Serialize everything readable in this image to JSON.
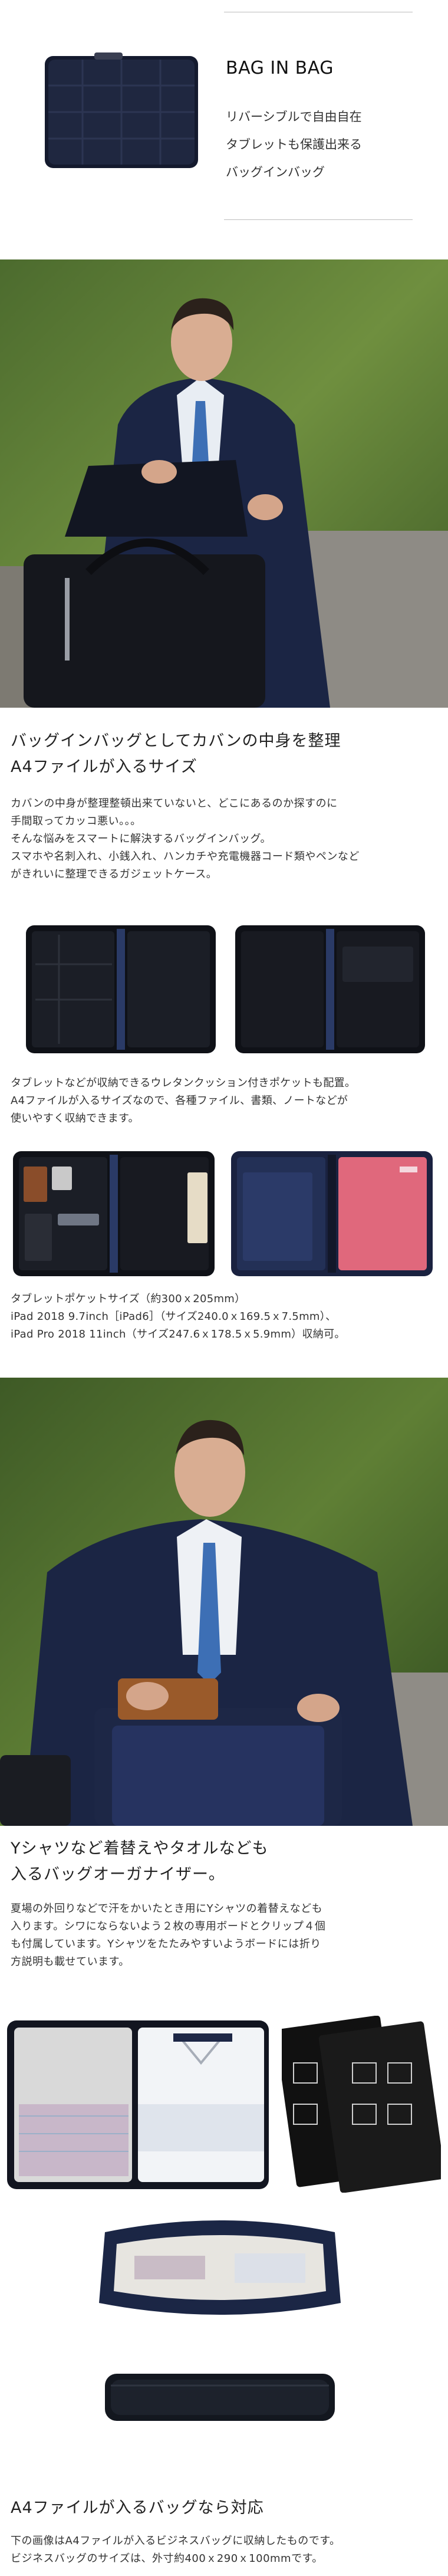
{
  "header": {
    "title": "BAG IN BAG",
    "tagline": [
      "リバーシブルで自由自在",
      "タブレットも保護出来る",
      "バッグインバッグ"
    ]
  },
  "section1": {
    "heading": [
      "バッグインバッグとしてカバンの中身を整理",
      "A4ファイルが入るサイズ"
    ],
    "body": [
      "カバンの中身が整理整頓出来ていないと、どこにあるのか探すのに",
      "手間取ってカッコ悪い。。。",
      "そんな悩みをスマートに解決するバッグインバッグ。",
      "スマホや名刺入れ、小銭入れ、ハンカチや充電機器コード類やペンなど",
      "がきれいに整理できるガジェットケース。"
    ],
    "caption1": [
      "タブレットなどが収納できるウレタンクッション付きポケットも配置。",
      "A4ファイルが入るサイズなので、各種ファイル、書類、ノートなどが",
      "使いやすく収納できます。"
    ],
    "caption2": [
      "タブレットポケットサイズ（約300ｘ205mm）",
      "iPad 2018 9.7inch［iPad6］（サイズ240.0ｘ169.5ｘ7.5mm）、",
      "iPad Pro 2018 11inch（サイズ247.6ｘ178.5ｘ5.9mm）収納可。"
    ]
  },
  "section2": {
    "heading": [
      "Yシャツなど着替えやタオルなども",
      "入るバッグオーガナイザー。"
    ],
    "body": [
      "夏場の外回りなどで汗をかいたとき用にYシャツの着替えなども",
      "入ります。シワにならないよう２枚の専用ボードとクリップ４個",
      "も付属しています。Yシャツをたたみやすいようボードには折り",
      "方説明も載せています。"
    ]
  },
  "section3": {
    "heading": "A4ファイルが入るバッグなら対応",
    "body": [
      "下の画像はA4ファイルが入るビジネスバッグに収納したものです。",
      "ビジネスバッグのサイズは、外寸約400ｘ290ｘ100mmです。"
    ]
  },
  "colors": {
    "navy": "#1d2540",
    "text": "#222222",
    "rule": "#bdbdbd",
    "pink": "#e0687c"
  }
}
